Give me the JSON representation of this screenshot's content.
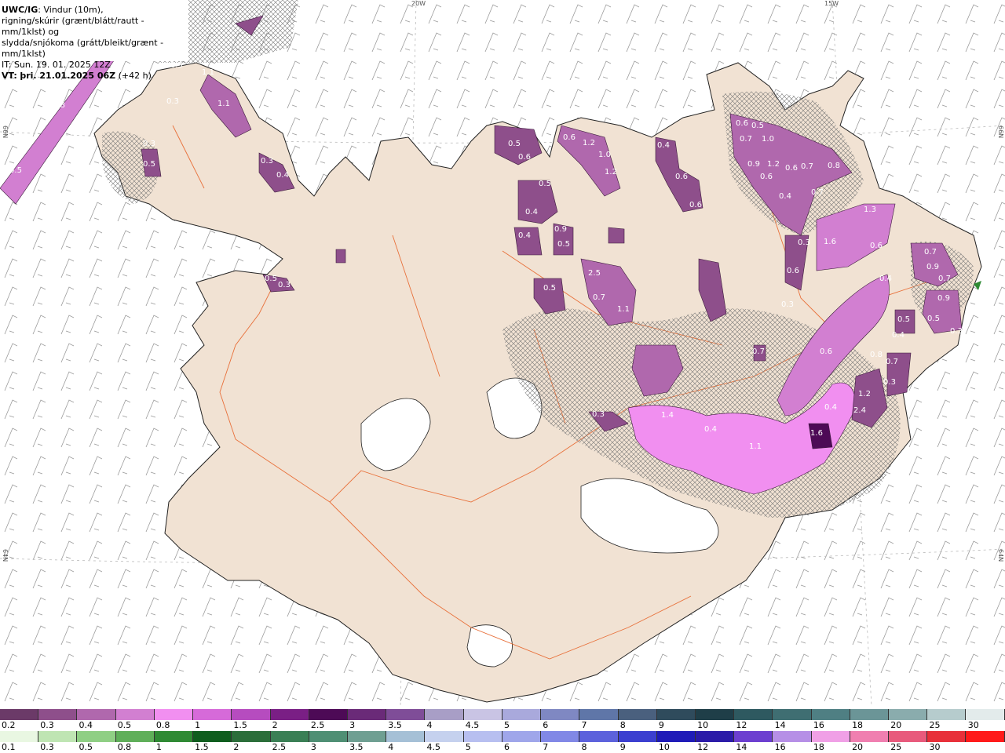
{
  "header": {
    "model": "UWC/IG",
    "line1_rest": ": Vindur (10m),",
    "line2": "rigning/skúrir (grænt/blátt/rautt - mm/1klst) og",
    "line3": "slydda/snjókoma (grátt/bleikt/grænt - mm/1klst)",
    "it": "IT: Sun. 19. 01. 2025 12Z",
    "vt_label": "VT:",
    "vt": "þri. 21.01.2025 06Z",
    "vt_offset": "(+42 h)"
  },
  "coords": {
    "w20": "20W",
    "w15": "15W",
    "n66_left": "66N",
    "n66_right": "66N",
    "n64_left": "64N",
    "n64_right": "64N"
  },
  "legend_top": {
    "labels": [
      "0.2",
      "0.3",
      "0.4",
      "0.5",
      "0.8",
      "1",
      "1.5",
      "2",
      "2.5",
      "3",
      "3.5",
      "4",
      "4.5",
      "5",
      "6",
      "7",
      "8",
      "9",
      "10",
      "12",
      "14",
      "16",
      "18",
      "20",
      "25",
      "30"
    ],
    "colors": [
      "#6b3a68",
      "#8e4f8b",
      "#b068ad",
      "#d27fd1",
      "#f18ff0",
      "#d66ad9",
      "#b64cbf",
      "#7a1f85",
      "#4d0a56",
      "#6a2a78",
      "#7f4d98",
      "#a89ec6",
      "#c9c4e4",
      "#a9a9dc",
      "#7f88c2",
      "#5f76a8",
      "#4a607e",
      "#2f4b5c",
      "#1f3e48",
      "#2e5960",
      "#3f6e72",
      "#4f7f83",
      "#6b9597",
      "#8aacad",
      "#b6cccd",
      "#e3ebeb"
    ]
  },
  "legend_bottom": {
    "labels": [
      "0.1",
      "0.3",
      "0.5",
      "0.8",
      "1",
      "1.5",
      "2",
      "2.5",
      "3",
      "3.5",
      "4",
      "4.5",
      "5",
      "6",
      "7",
      "8",
      "9",
      "10",
      "12",
      "14",
      "16",
      "18",
      "20",
      "25",
      "30"
    ],
    "colors": [
      "#e9f7e2",
      "#bfe5b3",
      "#8fcf84",
      "#5faf59",
      "#2f8a34",
      "#0f5d1e",
      "#2b6e3a",
      "#3a7f55",
      "#4f8f74",
      "#6f9f92",
      "#a5c0d6",
      "#c5d1ee",
      "#b7bff0",
      "#9fa6ea",
      "#8188e6",
      "#5c62dc",
      "#3b3fd0",
      "#1f1bb8",
      "#2b1ba8",
      "#6c3fd0",
      "#b68fe6",
      "#f0a0e6",
      "#f07fb0",
      "#e85a7c",
      "#e8303a",
      "#ff1a1a"
    ]
  },
  "precip_labels": [
    "0.5",
    "1.1",
    "1.1",
    "0.8",
    "0.5",
    "0.5",
    "0.3",
    "0.4",
    "0.3",
    "0.5",
    "0.3",
    "0.3",
    "0.6",
    "1.2",
    "1.0",
    "1.2",
    "0.5",
    "0.6",
    "0.4",
    "0.6",
    "0.6",
    "0.6",
    "0.5",
    "0.7",
    "1.0",
    "0.9",
    "1.2",
    "0.6",
    "0.7",
    "0.8",
    "0.6",
    "0.4",
    "0.7",
    "0.5",
    "0.4",
    "0.4",
    "0.9",
    "0.5",
    "0.5",
    "0.7",
    "2.5",
    "1.1",
    "1.3",
    "1.6",
    "0.6",
    "0.4",
    "0.6",
    "0.3",
    "0.3",
    "0.5",
    "0.7",
    "0.9",
    "0.7",
    "0.5",
    "0.9",
    "0.3",
    "0.8",
    "0.4",
    "0.6",
    "0.7",
    "1.2",
    "0.3",
    "0.4",
    "2.4",
    "1.6",
    "1.1",
    "1.4",
    "0.4",
    "0.3",
    "0.7"
  ]
}
